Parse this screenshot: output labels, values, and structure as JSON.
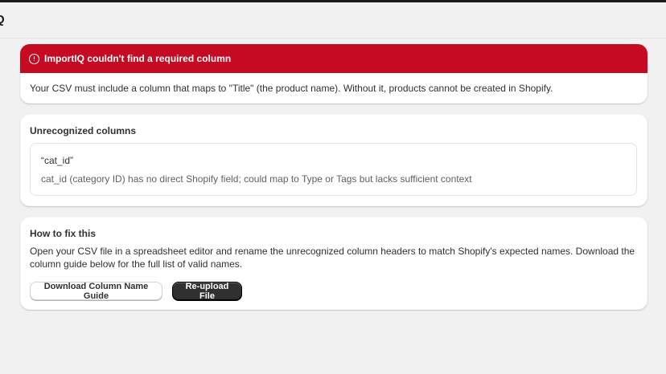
{
  "app": {
    "title": "Q"
  },
  "colors": {
    "critical": "#c70a24",
    "background": "#f1f1f1",
    "primary_button": "#303030"
  },
  "banner": {
    "icon": "alert-circle-icon",
    "title": "ImportIQ couldn't find a required column",
    "message": "Your CSV must include a column that maps to \"Title\" (the product name). Without it, products cannot be created in Shopify."
  },
  "unrecognized": {
    "heading": "Unrecognized columns",
    "items": [
      {
        "name": "“cat_id”",
        "description": "cat_id (category ID) has no direct Shopify field; could map to Type or Tags but lacks sufficient context"
      }
    ]
  },
  "fix": {
    "heading": "How to fix this",
    "text": "Open your CSV file in a spreadsheet editor and rename the unrecognized column headers to match Shopify's expected names. Download the column guide below for the full list of valid names.",
    "download_label": "Download Column Name Guide",
    "reupload_label": "Re-upload File"
  }
}
